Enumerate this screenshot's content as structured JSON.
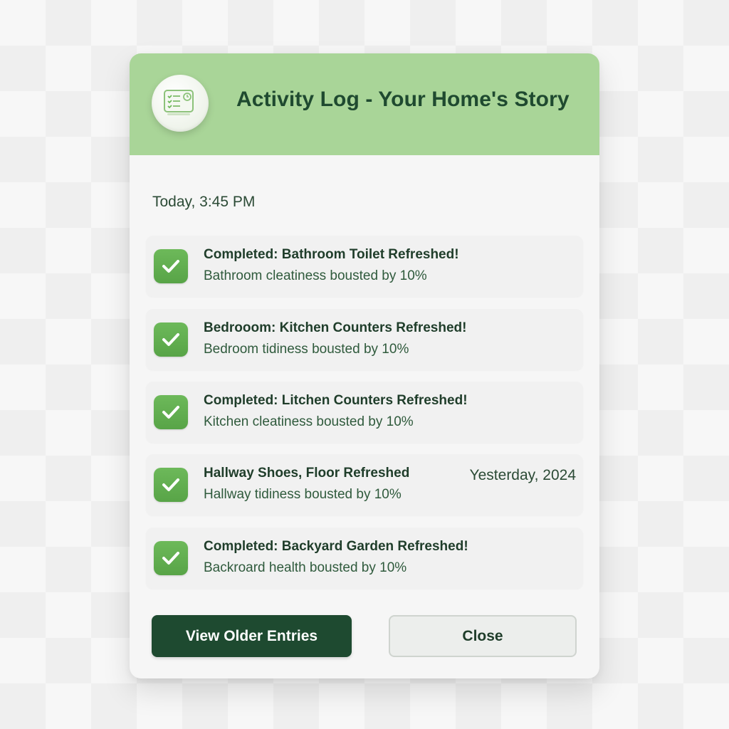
{
  "dialog": {
    "title": "Activity Log - Your Home's Story",
    "header_icon": "activity-log-icon",
    "header_color": "#a9d598",
    "accent_color": "#1e4a30"
  },
  "section": {
    "date": "Today, 3:45 PM"
  },
  "entries": [
    {
      "title": "Completed: Bathroom Toilet Refreshed!",
      "subtitle": "Bathroom cleatiness bousted by 10%",
      "icon": "checkmark-icon",
      "date": ""
    },
    {
      "title": "Bedrooom: Kitchen Counters Refreshed!",
      "subtitle": "Bedroom tidiness bousted by 10%",
      "icon": "checkmark-icon",
      "date": ""
    },
    {
      "title": "Completed: Litchen Counters Refreshed!",
      "subtitle": "Kitchen cleatiness bousted by 10%",
      "icon": "checkmark-icon",
      "date": ""
    },
    {
      "title": "Hallway Shoes, Floor  Refreshed",
      "subtitle": "Hallway tidiness bousted by 10%",
      "icon": "checkmark-icon",
      "date": "Yesterday, 2024"
    },
    {
      "title": "Completed: Backyard Garden Refreshed!",
      "subtitle": "Backroard health bousted by 10%",
      "icon": "checkmark-icon",
      "date": ""
    }
  ],
  "buttons": {
    "older_label": "View Older Entries",
    "close_label": "Close"
  }
}
